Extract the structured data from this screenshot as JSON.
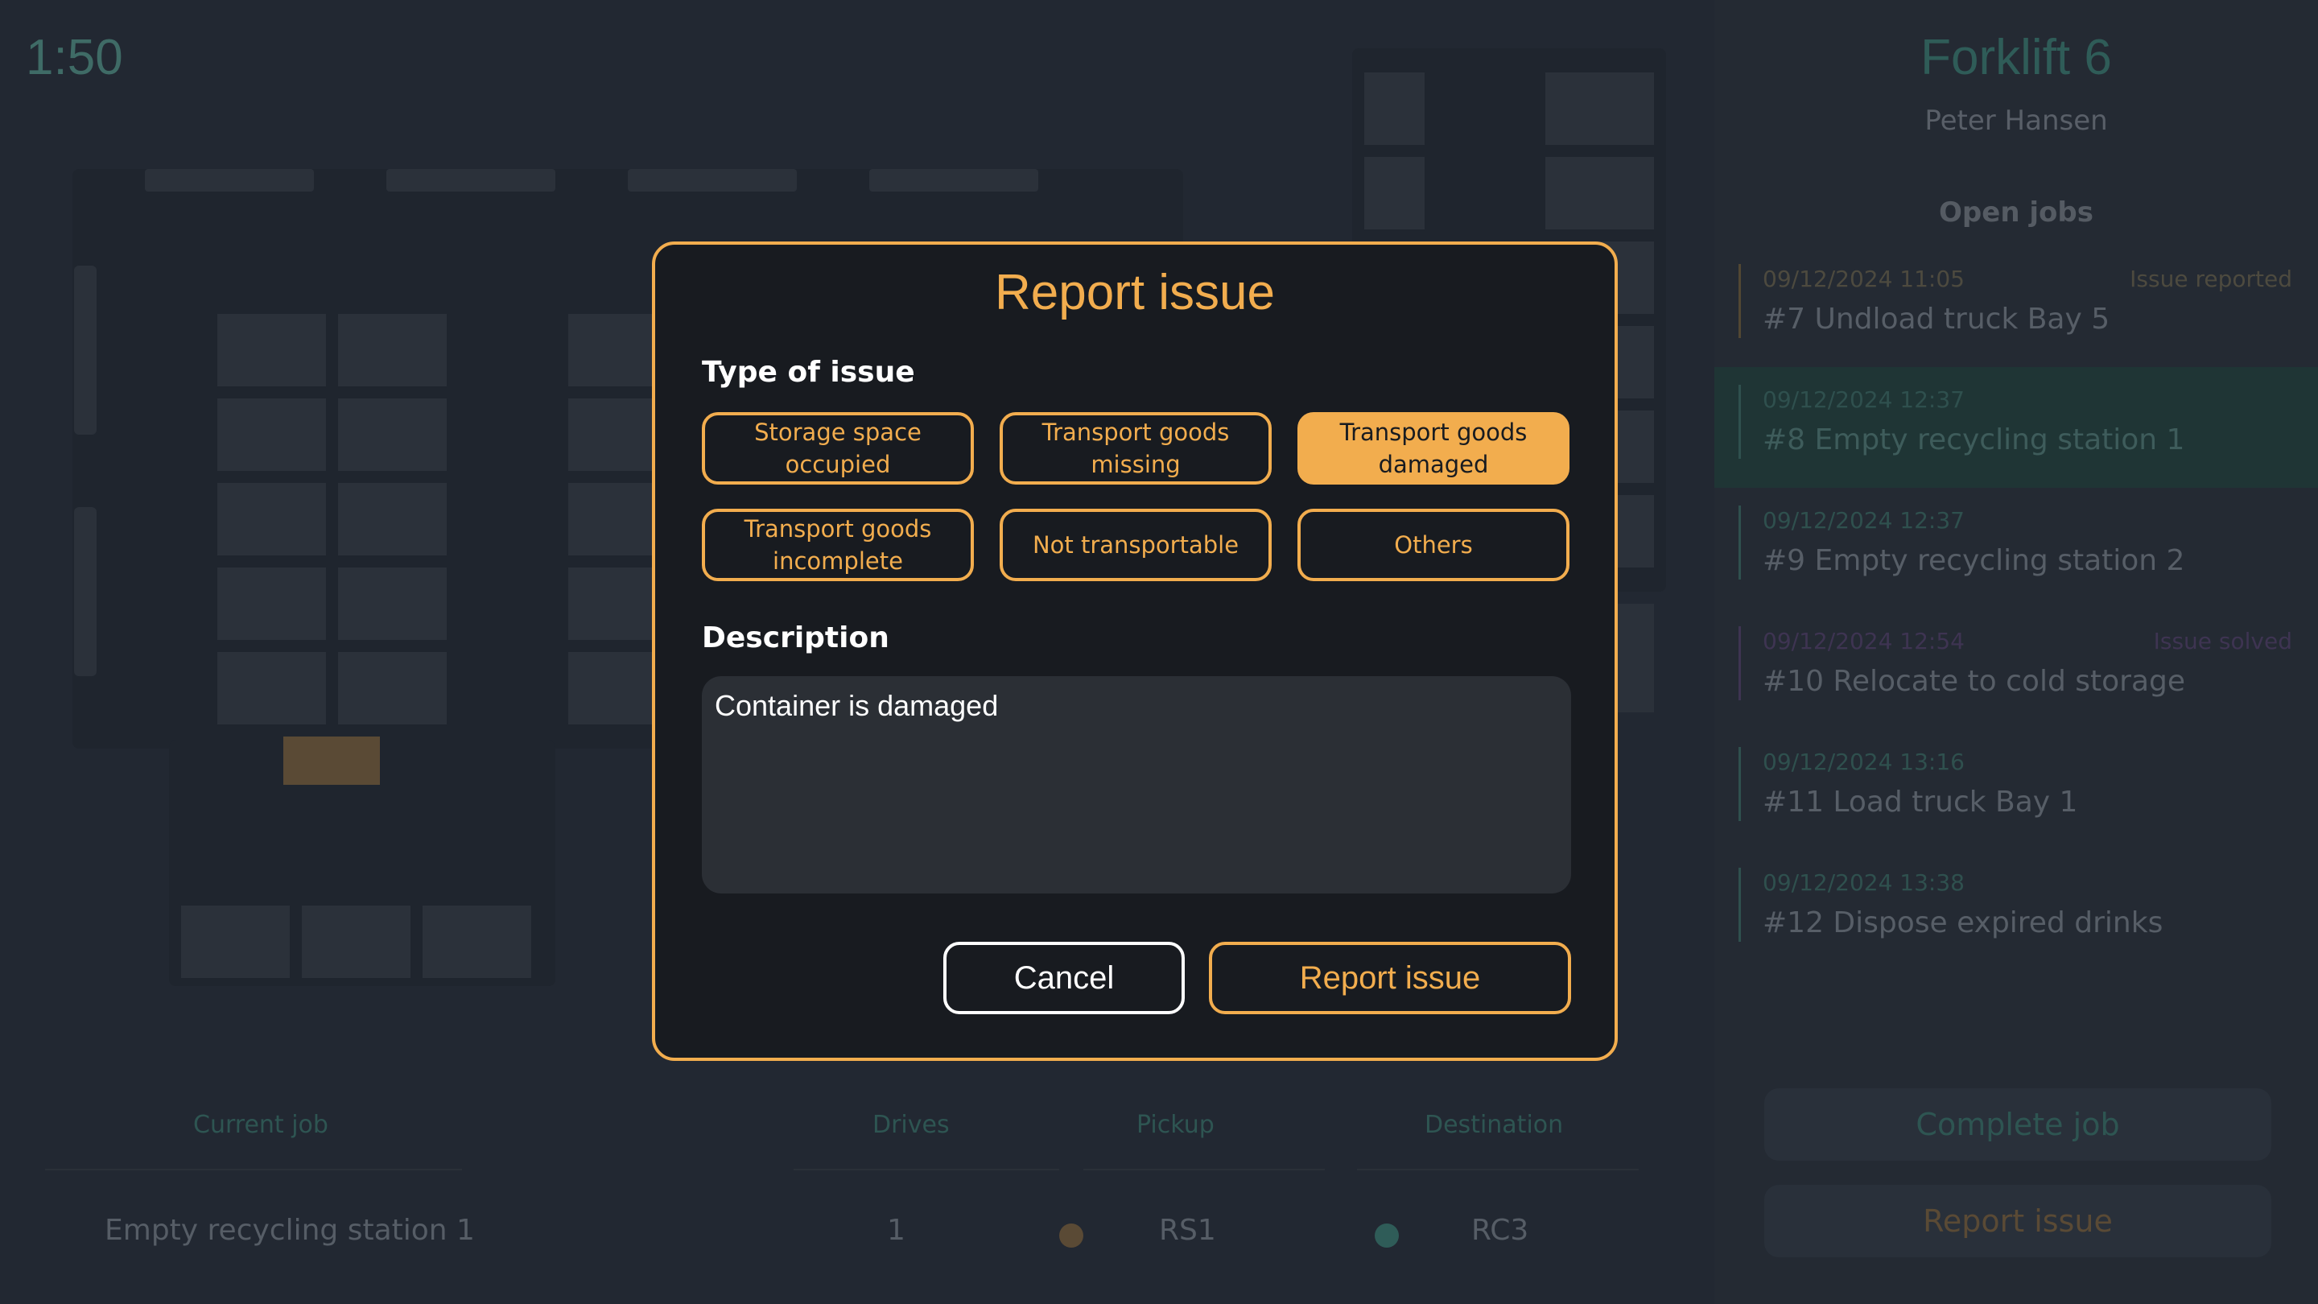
{
  "clock": "1:50",
  "panel": {
    "truck_name": "Forklift 6",
    "driver": "Peter Hansen",
    "open_jobs_heading": "Open jobs",
    "jobs": [
      {
        "date": "09/12/2024  11:05",
        "title": "#7 Undload truck Bay 5",
        "flag": "Issue reported"
      },
      {
        "date": "09/12/2024  12:37",
        "title": "#8 Empty recycling station 1",
        "flag": ""
      },
      {
        "date": "09/12/2024  12:37",
        "title": "#9 Empty recycling station 2",
        "flag": ""
      },
      {
        "date": "09/12/2024  12:54",
        "title": "#10 Relocate to cold storage",
        "flag": "Issue solved"
      },
      {
        "date": "09/12/2024  13:16",
        "title": "#11 Load truck Bay 1",
        "flag": ""
      },
      {
        "date": "09/12/2024  13:38",
        "title": "#12 Dispose expired drinks",
        "flag": ""
      }
    ],
    "complete_label": "Complete job",
    "report_label": "Report issue"
  },
  "job_table": {
    "headers": {
      "current": "Current job",
      "drives": "Drives",
      "pickup": "Pickup",
      "destination": "Destination"
    },
    "row": {
      "current": "Empty recycling station 1",
      "drives": "1",
      "pickup": "RS1",
      "destination": "RC3"
    },
    "pickup_color": "#5a4a35",
    "destination_color": "#2f5c58"
  },
  "modal": {
    "title": "Report issue",
    "type_heading": "Type of issue",
    "options": [
      {
        "label": "Storage space occupied",
        "selected": false
      },
      {
        "label": "Transport goods missing",
        "selected": false
      },
      {
        "label": "Transport goods damaged",
        "selected": true
      },
      {
        "label": "Transport goods incomplete",
        "selected": false
      },
      {
        "label": "Not transportable",
        "selected": false
      },
      {
        "label": "Others",
        "selected": false
      }
    ],
    "description_heading": "Description",
    "description_value": "Container is damaged",
    "cancel_label": "Cancel",
    "submit_label": "Report issue"
  },
  "colors": {
    "accent": "#f2ad4e",
    "background": "#222832",
    "modal": "#181b20"
  }
}
